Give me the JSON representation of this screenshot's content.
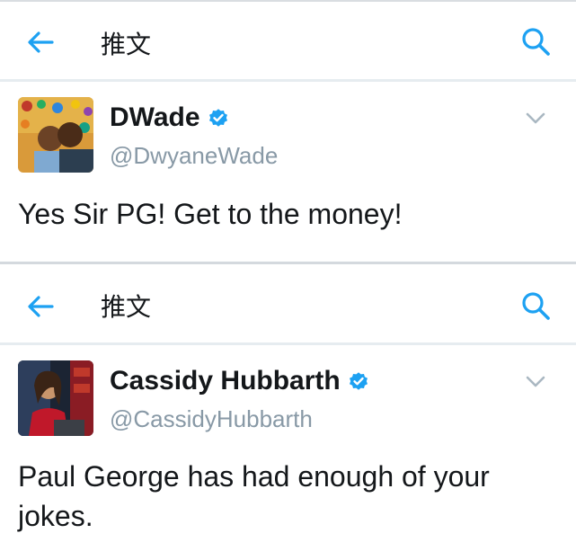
{
  "screens": [
    {
      "header": {
        "title": "推文"
      },
      "tweet": {
        "display_name": "DWade",
        "handle": "@DwyaneWade",
        "text": "Yes Sir PG! Get to the money!"
      }
    },
    {
      "header": {
        "title": "推文"
      },
      "tweet": {
        "display_name": "Cassidy Hubbarth",
        "handle": "@CassidyHubbarth",
        "text_lines": [
          "Paul George has had enough of your",
          "jokes."
        ]
      }
    }
  ],
  "icons": {
    "back": "arrow-left-icon",
    "search": "search-icon",
    "verified": "verified-badge-icon",
    "more": "chevron-down-icon"
  },
  "colors": {
    "accent": "#1da1f2",
    "text": "#14171a",
    "muted": "#8899a6",
    "chevron": "#aab8c2"
  }
}
